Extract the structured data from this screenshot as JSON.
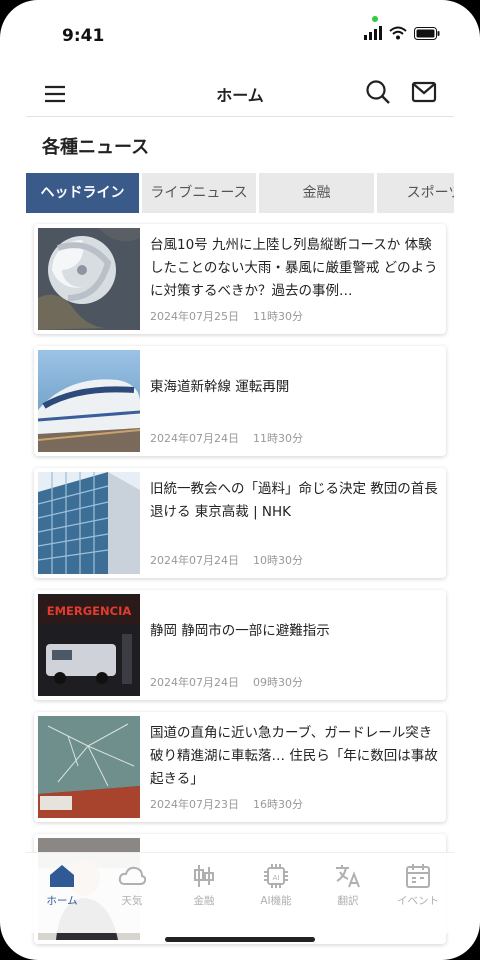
{
  "status_bar": {
    "time": "9:41"
  },
  "header": {
    "title": "ホーム"
  },
  "section": {
    "title": "各種ニュース"
  },
  "tabs": [
    {
      "label": "ヘッドライン",
      "active": true
    },
    {
      "label": "ライブニュース",
      "active": false
    },
    {
      "label": "金融",
      "active": false
    },
    {
      "label": "スポーツ",
      "active": false
    }
  ],
  "news": [
    {
      "title": "台風10号 九州に上陸し列島縦断コースか 体験したことのない大雨・暴風に厳重警戒 どのように対策するべきか？過去の事例…",
      "date": "2024年07月25日",
      "time": "11時30分",
      "thumb": "typhoon"
    },
    {
      "title": "東海道新幹線 運転再開",
      "date": "2024年07月24日",
      "time": "11時30分",
      "thumb": "train"
    },
    {
      "title": "旧統一教会への「過料」命じる決定 教団の首長退ける 東京高裁 | NHK",
      "date": "2024年07月24日",
      "time": "10時30分",
      "thumb": "building"
    },
    {
      "title": "静岡 静岡市の一部に避難指示",
      "date": "2024年07月24日",
      "time": "09時30分",
      "thumb": "emergency",
      "thumb_text": "EMERGENCIA"
    },
    {
      "title": "国道の直角に近い急カーブ、ガードレール突き破り精進湖に車転落… 住民ら「年に数回は事故起きる」",
      "date": "2024年07月23日",
      "time": "16時30分",
      "thumb": "car"
    },
    {
      "title": "",
      "date": "",
      "time": "",
      "thumb": "person"
    }
  ],
  "bottom_nav": [
    {
      "label": "ホーム",
      "icon": "home-icon",
      "active": true
    },
    {
      "label": "天気",
      "icon": "cloud-icon",
      "active": false
    },
    {
      "label": "金融",
      "icon": "candlestick-icon",
      "active": false
    },
    {
      "label": "AI機能",
      "icon": "ai-chip-icon",
      "active": false
    },
    {
      "label": "翻訳",
      "icon": "translate-icon",
      "active": false
    },
    {
      "label": "イベント",
      "icon": "calendar-icon",
      "active": false
    }
  ],
  "colors": {
    "accent": "#3a5a8a",
    "nav_active": "#2f5a96",
    "nav_inactive": "#b0b0b0"
  }
}
